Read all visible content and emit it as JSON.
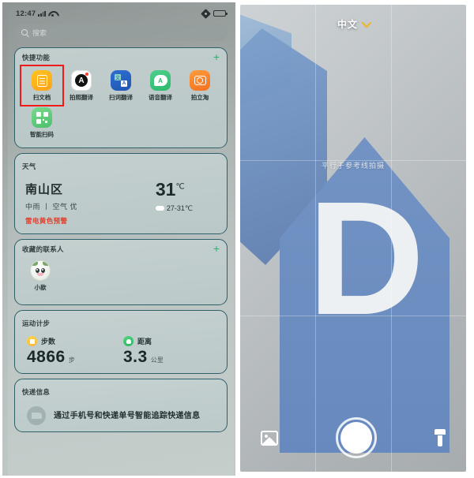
{
  "left": {
    "status_bar": {
      "clock": "12:47",
      "signal_icon": "signal-bars-icon",
      "wifi_icon": "wifi-icon",
      "rotation_icon": "rotation-lock-icon",
      "battery_icon": "battery-icon"
    },
    "search": {
      "icon": "search-icon",
      "placeholder": "搜索"
    },
    "quick_functions": {
      "title": "快捷功能",
      "add_label": "+",
      "items": [
        {
          "label": "扫文档",
          "icon": "scan-document-icon",
          "highlighted": true
        },
        {
          "label": "拍照翻译",
          "icon": "photo-translate-icon",
          "highlighted": false
        },
        {
          "label": "扫词翻译",
          "icon": "word-scan-translate-icon",
          "highlighted": false
        },
        {
          "label": "语音翻译",
          "icon": "voice-translate-icon",
          "highlighted": false
        },
        {
          "label": "拍立淘",
          "icon": "shop-camera-icon",
          "highlighted": false
        },
        {
          "label": "智能扫码",
          "icon": "qr-scan-icon",
          "highlighted": false
        }
      ]
    },
    "weather": {
      "title": "天气",
      "city": "南山区",
      "temperature": "31",
      "temperature_unit": "℃",
      "condition": "中雨 丨 空气 优",
      "range": "27-31℃",
      "range_icon": "cloud-icon",
      "alert": "雷电黄色预警",
      "alert_color": "#e2402e"
    },
    "contacts": {
      "title": "收藏的联系人",
      "add_label": "+",
      "items": [
        {
          "name": "小歆",
          "avatar": "contact-avatar"
        }
      ]
    },
    "steps": {
      "title": "运动计步",
      "metrics": [
        {
          "label": "步数",
          "value": "4866",
          "unit": "步",
          "icon": "steps-icon",
          "color": "#f7b733"
        },
        {
          "label": "距离",
          "value": "3.3",
          "unit": "公里",
          "icon": "distance-icon",
          "color": "#27b661"
        }
      ]
    },
    "express": {
      "title": "快递信息",
      "icon": "delivery-truck-icon",
      "description": "通过手机号和快递单号智能追踪快递信息"
    }
  },
  "right": {
    "language": {
      "label": "中文",
      "chevron_icon": "chevron-down-icon",
      "chevron_color": "#f0b429"
    },
    "hint": "平行于参考线拍摄",
    "preview": {
      "letter": "D",
      "shape_color": "#6f8fbf"
    },
    "controls": {
      "gallery": {
        "label": "",
        "icon": "gallery-icon"
      },
      "shutter": {
        "label": "",
        "icon": "shutter-button-icon"
      },
      "torch": {
        "label": "",
        "icon": "flashlight-icon"
      }
    }
  }
}
